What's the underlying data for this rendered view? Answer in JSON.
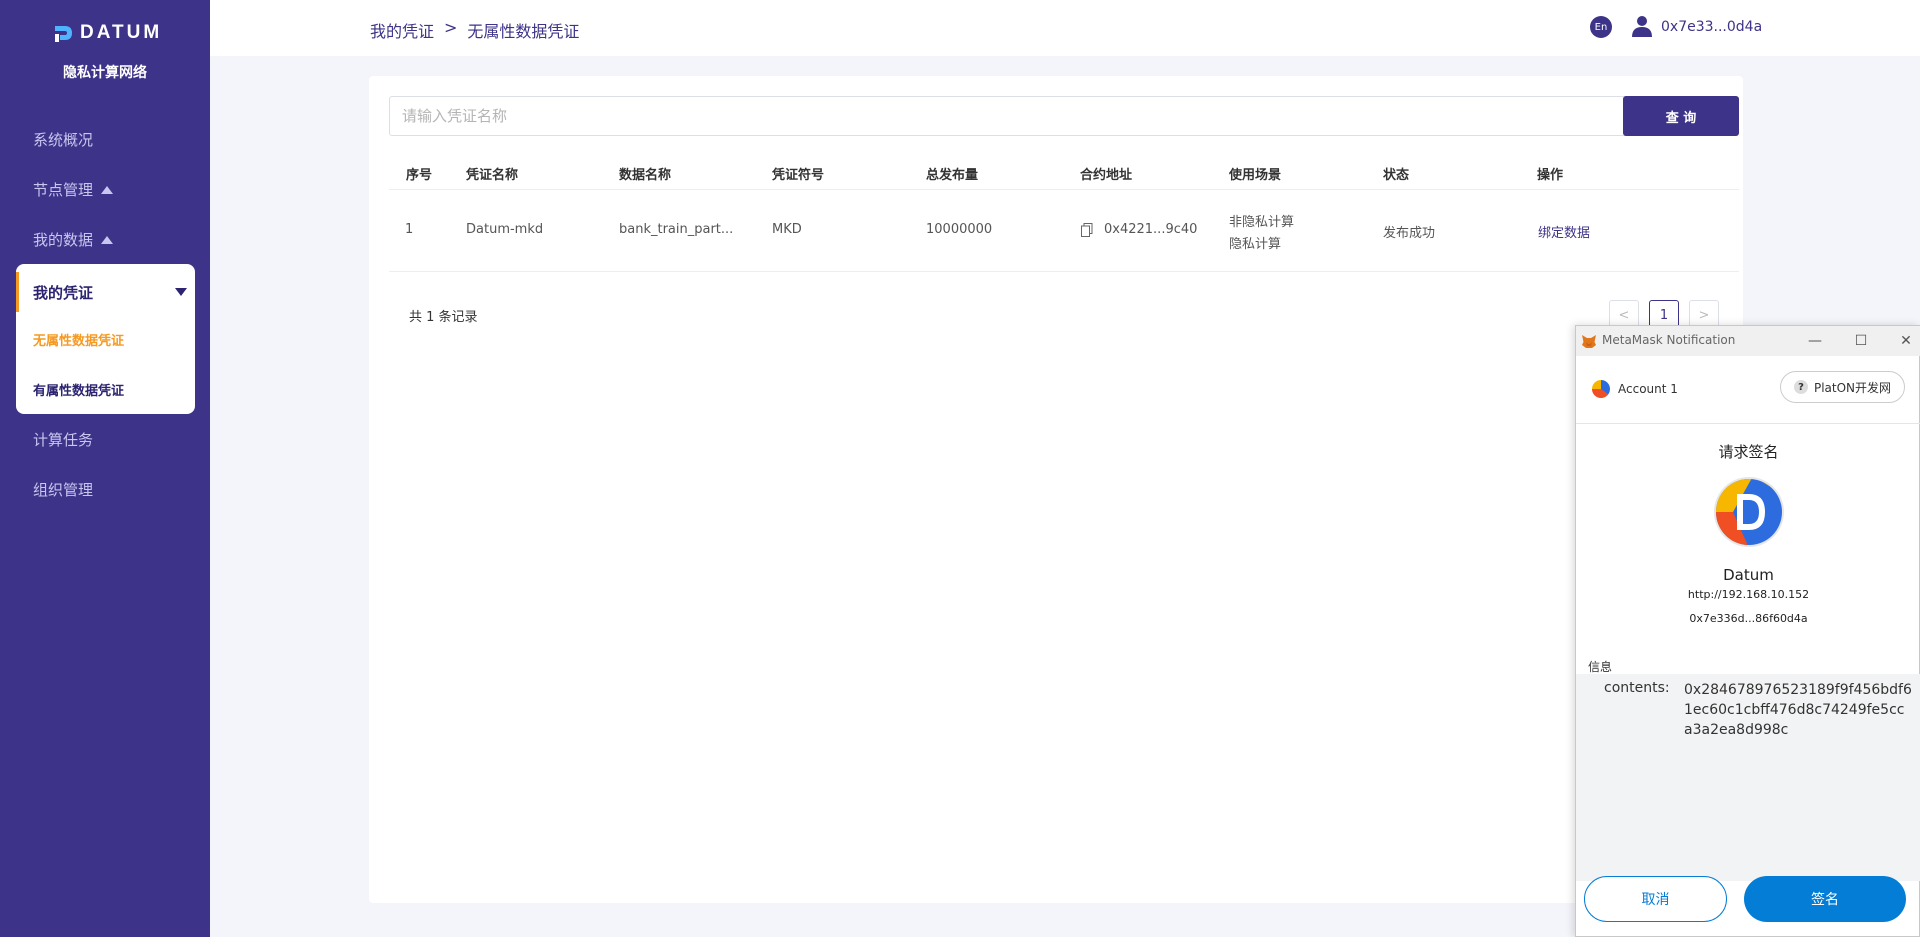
{
  "sidebar": {
    "logo_text": "DATUM",
    "subtitle": "隐私计算网络",
    "items": [
      {
        "label": "系统概况"
      },
      {
        "label": "节点管理"
      },
      {
        "label": "我的数据"
      },
      {
        "label": "我的凭证"
      },
      {
        "label": "计算任务"
      },
      {
        "label": "组织管理"
      }
    ],
    "credential_sub": [
      {
        "label": "无属性数据凭证",
        "active": true
      },
      {
        "label": "有属性数据凭证",
        "active": false
      }
    ]
  },
  "header": {
    "breadcrumb": [
      "我的凭证",
      ">",
      "无属性数据凭证"
    ],
    "lang": "En",
    "user_address": "0x7e33...0d4a"
  },
  "search": {
    "placeholder": "请输入凭证名称",
    "button_label": "查 询"
  },
  "table": {
    "columns": [
      "序号",
      "凭证名称",
      "数据名称",
      "凭证符号",
      "总发布量",
      "合约地址",
      "使用场景",
      "状态",
      "操作"
    ],
    "rows": [
      {
        "index": "1",
        "credential_name": "Datum-mkd",
        "data_name": "bank_train_part...",
        "symbol": "MKD",
        "total_supply": "10000000",
        "contract": "0x4221...9c40",
        "scenario_1": "非隐私计算",
        "scenario_2": "隐私计算",
        "status": "发布成功",
        "action": "绑定数据"
      }
    ],
    "total_text": "共 1 条记录"
  },
  "pagination": {
    "prev": "<",
    "current": "1",
    "next": ">"
  },
  "metamask": {
    "window_title": "MetaMask Notification",
    "account": "Account 1",
    "network": "PlatON开发网",
    "network_badge": "?",
    "heading": "请求签名",
    "site_name": "Datum",
    "site_url": "http://192.168.10.152",
    "address": "0x7e336d...86f60d4a",
    "info_label": "信息",
    "message_key": "contents:",
    "message_value": "0x284678976523189f9f456bdf61ec60c1cbff476d8c74249fe5cca3a2ea8d998c",
    "cancel_label": "取消",
    "sign_label": "签名"
  },
  "colors": {
    "primary": "#3d3388",
    "accent": "#f59a23",
    "metamask_blue": "#037dd6"
  }
}
